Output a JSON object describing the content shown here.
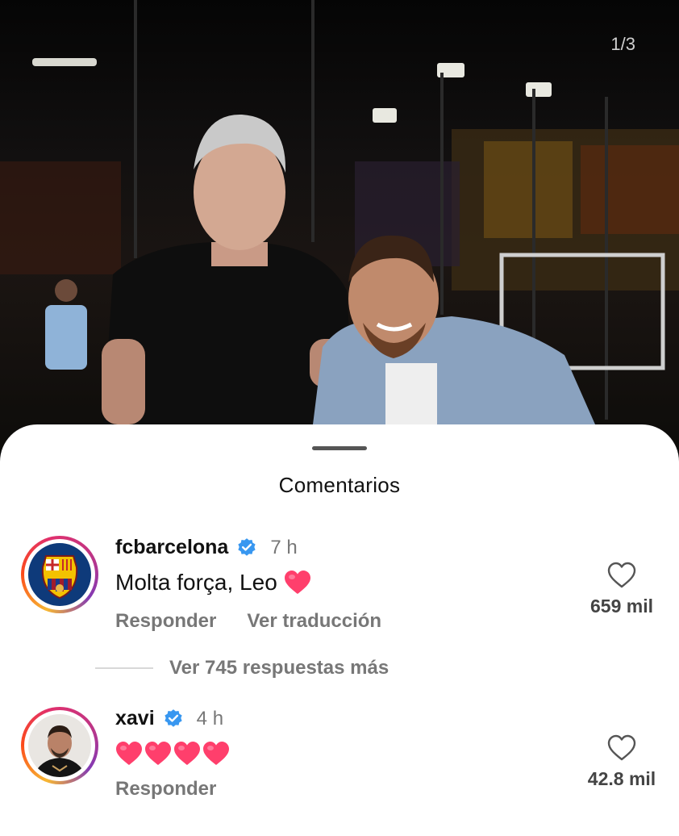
{
  "photo": {
    "page_counter": "1/3"
  },
  "sheet": {
    "title": "Comentarios"
  },
  "comments": [
    {
      "username": "fcbarcelona",
      "verified": true,
      "time": "7 h",
      "text": "Molta força, Leo",
      "emoji": "heart-emoji",
      "reply_label": "Responder",
      "translate_label": "Ver traducción",
      "like_count": "659 mil",
      "replies_label": "Ver 745 respuestas más"
    },
    {
      "username": "xavi",
      "verified": true,
      "time": "4 h",
      "emoji_count": 4,
      "emoji": "heart-emoji",
      "reply_label": "Responder",
      "like_count": "42.8 mil"
    }
  ],
  "colors": {
    "verified_blue": "#3897f0",
    "heart_pink": "#ff3f6c",
    "muted_text": "#777777"
  }
}
